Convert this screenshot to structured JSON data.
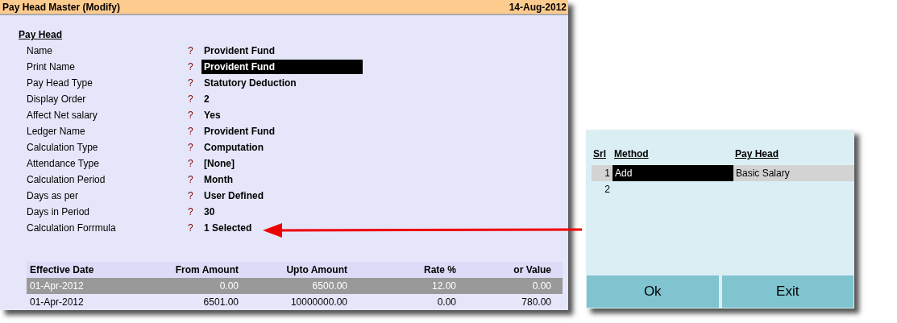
{
  "window": {
    "title": "Pay Head Master (Modify)",
    "date": "14-Aug-2012"
  },
  "section_title": "Pay Head",
  "fields": [
    {
      "label": "Name",
      "value": "Provident Fund",
      "selected": false
    },
    {
      "label": "Print Name",
      "value": "Provident Fund",
      "selected": true
    },
    {
      "label": "Pay Head Type",
      "value": "Statutory Deduction",
      "selected": false
    },
    {
      "label": "Display Order",
      "value": "2",
      "selected": false
    },
    {
      "label": "Affect Net salary",
      "value": "Yes",
      "selected": false
    },
    {
      "label": "Ledger Name",
      "value": "Provident Fund",
      "selected": false
    },
    {
      "label": "Calculation Type",
      "value": "Computation",
      "selected": false
    },
    {
      "label": "Attendance Type",
      "value": "[None]",
      "selected": false
    },
    {
      "label": "Calculation Period",
      "value": "Month",
      "selected": false
    },
    {
      "label": "Days as per",
      "value": "User Defined",
      "selected": false
    },
    {
      "label": "Days in Period",
      "value": "30",
      "selected": false
    },
    {
      "label": "Calculation Forrmula",
      "value": "1 Selected",
      "selected": false
    }
  ],
  "prompt_mark": "?",
  "table": {
    "columns": [
      "Effective Date",
      "From Amount",
      "Upto Amount",
      "Rate %",
      "or Value"
    ],
    "rows": [
      {
        "cells": [
          "01-Apr-2012",
          "0.00",
          "6500.00",
          "12.00",
          "0.00"
        ],
        "selected": true
      },
      {
        "cells": [
          "01-Apr-2012",
          "6501.00",
          "10000000.00",
          "0.00",
          "780.00"
        ],
        "selected": false
      }
    ]
  },
  "formula_dialog": {
    "columns": [
      "Srl",
      "Method",
      "Pay Head"
    ],
    "rows": [
      {
        "srl": "1",
        "method": "Add",
        "pay_head": "Basic Salary",
        "selected": true
      },
      {
        "srl": "2",
        "selected": false
      }
    ],
    "buttons": [
      "Ok",
      "Exit"
    ]
  }
}
